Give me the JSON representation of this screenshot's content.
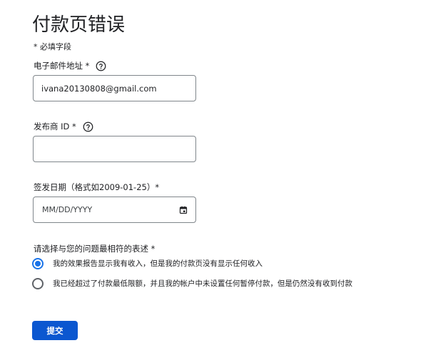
{
  "page": {
    "title": "付款页错误",
    "required_note": "* 必填字段"
  },
  "email": {
    "label": "电子邮件地址 *",
    "value": "ivana20130808@gmail.com",
    "help_icon": "help-circle-icon"
  },
  "publisher_id": {
    "label": "发布商 ID *",
    "value": "",
    "help_icon": "help-circle-icon"
  },
  "issue_date": {
    "label": "签发日期（格式如2009-01-25）*",
    "placeholder": "MM/DD/YYYY",
    "icon": "calendar-icon"
  },
  "problem": {
    "label": "请选择与您的问题最相符的表述 *",
    "options": [
      {
        "label": "我的效果报告显示我有收入，但是我的付款页没有显示任何收入",
        "selected": true
      },
      {
        "label": "我已经超过了付款最低限额，并且我的帐户中未设置任何暂停付款，但是仍然没有收到付款",
        "selected": false
      }
    ]
  },
  "submit": {
    "label": "提交"
  },
  "colors": {
    "accent": "#1a73e8",
    "button": "#0b57d0",
    "border": "#80868b",
    "text": "#202124"
  }
}
